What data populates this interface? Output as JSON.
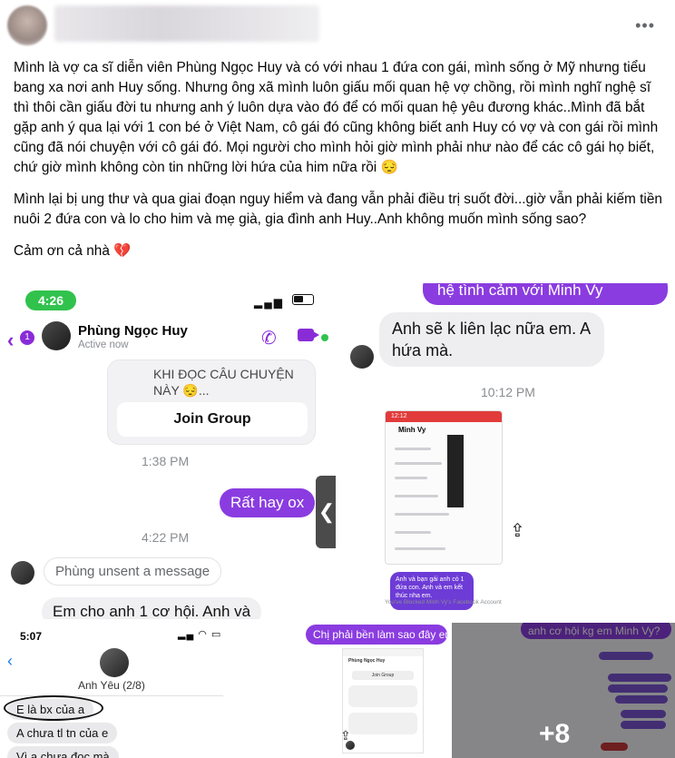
{
  "header": {
    "more_icon": "more-horizontal-icon",
    "more_label": "•••"
  },
  "post": {
    "paragraphs": [
      "Mình là vợ ca sĩ diễn viên Phùng Ngọc Huy và có với nhau 1 đứa con gái, mình sống ở Mỹ nhưng tiểu bang xa nơi anh Huy sống. Nhưng ông xã mình luôn giấu mối quan hệ vợ chồng, rồi mình nghĩ nghệ sĩ thì thôi cần giấu đời tu nhưng anh ý luôn dựa vào đó để có mối quan hệ yêu đương khác..Mình đã bắt gặp anh ý qua lại với 1 con bé ở Việt Nam, cô gái đó cũng không biết anh Huy có vợ và con gái rồi mình cũng đã nói chuyện với cô gái đó. Mọi người cho mình hỏi giờ mình phải như nào để các cô gái họ biết, chứ giờ mình không còn tin những lời hứa của him nữa rồi 😔",
      "Mình lại bị ung thư và qua giai đoạn nguy hiểm và đang vẫn phải điều trị suốt đời...giờ vẫn phải kiếm tiền nuôi 2 đứa con và lo cho him và mẹ già, gia đình anh Huy..Anh không muốn mình sống sao?",
      "Cảm ơn cả nhà 💔"
    ]
  },
  "photo1": {
    "time": "4:26",
    "back_count": "1",
    "contact_name": "Phùng Ngọc Huy",
    "contact_status": "Active now",
    "card_text": "KHI ĐỌC CÂU CHUYỆN NÀY 😔...",
    "join_label": "Join Group",
    "ts1": "1:38 PM",
    "msg_out": "Rất hay ox",
    "ts2": "4:22 PM",
    "unsent": "Phùng unsent a message",
    "msg_in": "Em cho anh 1 cơ hội. Anh và",
    "handle": "❮"
  },
  "photo2": {
    "top_msg": "hệ tình cảm với Minh Vy",
    "bubble": "Anh sẽ k liên lạc nữa em. A hứa mà.",
    "ts": "10:12 PM",
    "inner_name": "Minh Vy",
    "inner_purple": "Anh và bạn gái anh có 1 đứa con. Anh và em kết thúc nha em.",
    "blocked": "You've Blocked Minh Vy's Facebook Account"
  },
  "photo3": {
    "time": "5:07",
    "name": "Anh Yêu (2/8)",
    "msgs": [
      "E là bx của a",
      "A chưa tl tn của e",
      "Vì a chưa đọc mà"
    ]
  },
  "photo4": {
    "top": "Chị phải bền làm sao đây em",
    "mini_name": "Phùng Ngọc Huy",
    "mini_join": "Join Group"
  },
  "photo5": {
    "top": "anh cơ hội kg em Minh Vy?",
    "more": "+8"
  }
}
